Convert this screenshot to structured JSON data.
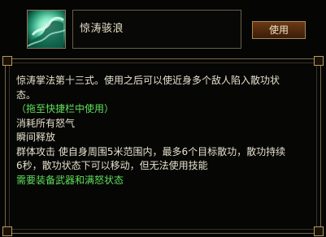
{
  "skill": {
    "name": "惊涛骇浪",
    "icon": "wave-skill-icon"
  },
  "buttons": {
    "use_label": "使用"
  },
  "description": {
    "line1": "惊涛掌法第十三式。使用之后可以使近身多个敌人陷入散功状",
    "line2": "态。",
    "hint": "（拖至快捷栏中使用）",
    "cost": "消耗所有怒气",
    "cast": "瞬间释放",
    "effect1": "群体攻击  使自身周围5米范围内，最多6个目标散功，散功持续",
    "effect2": "6秒，散功状态下可以移动，但无法使用技能",
    "requirement": "需要装备武器和满怒状态"
  },
  "colors": {
    "text": "#e6e0cc",
    "highlight": "#5fe05a",
    "border": "#7a6a4a"
  }
}
